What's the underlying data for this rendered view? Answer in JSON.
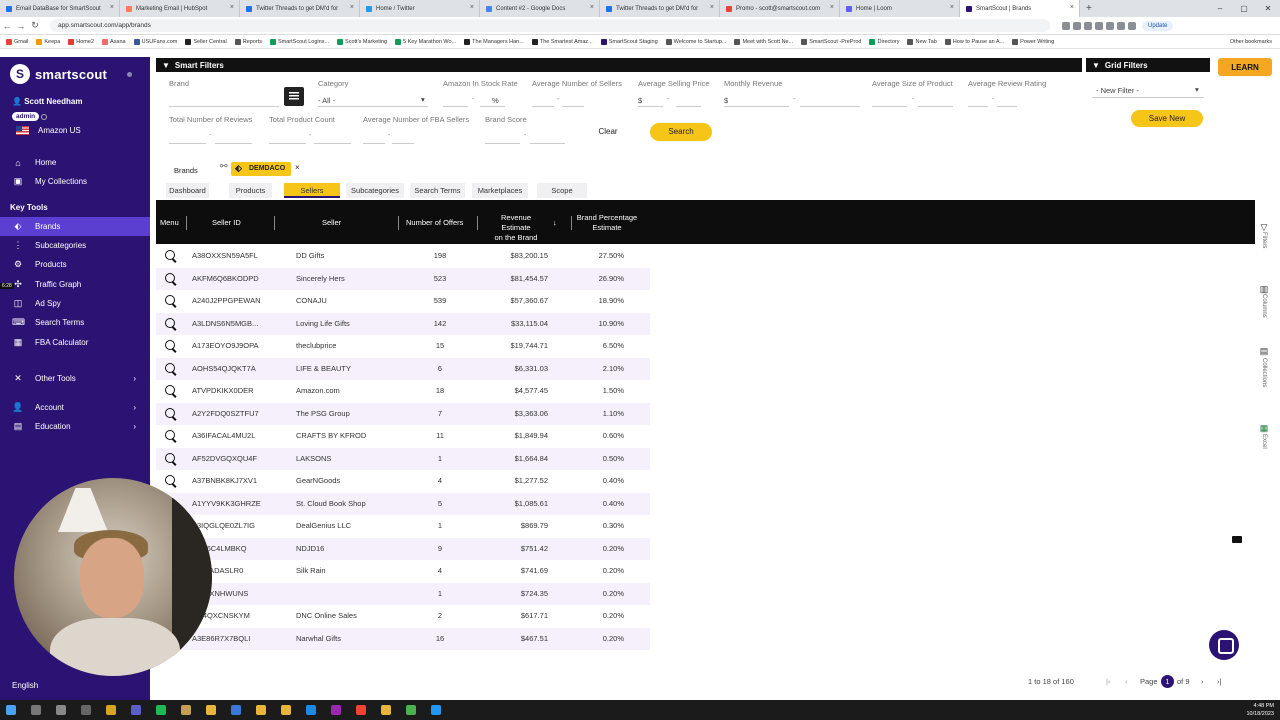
{
  "browser": {
    "tabs": [
      {
        "label": "Email DataBase for SmartScout",
        "color": "#1a73e8"
      },
      {
        "label": "Marketing Email | HubSpot",
        "color": "#ff7a59"
      },
      {
        "label": "Twitter Threads to get DM'd for",
        "color": "#1a73e8"
      },
      {
        "label": "Home / Twitter",
        "color": "#1d9bf0"
      },
      {
        "label": "Content #2 - Google Docs",
        "color": "#4285f4"
      },
      {
        "label": "Twitter Threads to get DM'd for",
        "color": "#1a73e8"
      },
      {
        "label": "Promo - scott@smartscout.com",
        "color": "#ea4335"
      },
      {
        "label": "Home | Loom",
        "color": "#625df5"
      },
      {
        "label": "SmartScout | Brands",
        "color": "#2b1373"
      }
    ],
    "url": "app.smartscout.com/app/brands",
    "update_label": "Update",
    "bookmarks": [
      {
        "label": "Gmail",
        "color": "#ea4335"
      },
      {
        "label": "Keepa",
        "color": "#f29900"
      },
      {
        "label": "Home2",
        "color": "#e53935"
      },
      {
        "label": "Asana",
        "color": "#f06a6a"
      },
      {
        "label": "USUFans.com",
        "color": "#3b5998"
      },
      {
        "label": "Seller Central",
        "color": "#222222"
      },
      {
        "label": "Reports",
        "color": "#555555"
      },
      {
        "label": "SmartScout Logins...",
        "color": "#0f9d58"
      },
      {
        "label": "Scott's Marketing",
        "color": "#0f9d58"
      },
      {
        "label": "5 Key Marathon Wo...",
        "color": "#0f9d58"
      },
      {
        "label": "The Managers Han...",
        "color": "#222222"
      },
      {
        "label": "The Smartest Amaz...",
        "color": "#222222"
      },
      {
        "label": "SmartScout Staging",
        "color": "#2b1373"
      },
      {
        "label": "Welcome to Startup...",
        "color": "#555555"
      },
      {
        "label": "Meet with Scott Ne...",
        "color": "#555555"
      },
      {
        "label": "SmartScout -PreProd",
        "color": "#555555"
      },
      {
        "label": "Directory",
        "color": "#0f9d58"
      },
      {
        "label": "New Tab",
        "color": "#555555"
      },
      {
        "label": "How to Pause an A...",
        "color": "#555555"
      },
      {
        "label": "Power Writing",
        "color": "#555555"
      }
    ],
    "other_bookmarks": "Other bookmarks"
  },
  "sidebar": {
    "logo_text": "smartscout",
    "logo_mark": "S",
    "user_name": "Scott Needham",
    "role_badge": "admin",
    "marketplace": "Amazon US",
    "home": "Home",
    "my_collections": "My Collections",
    "key_tools_heading": "Key Tools",
    "tools": [
      {
        "label": "Brands",
        "icon": "tag-icon",
        "glyph": "⬖",
        "active": true
      },
      {
        "label": "Subcategories",
        "icon": "subcategories-icon",
        "glyph": "⋮"
      },
      {
        "label": "Products",
        "icon": "products-icon",
        "glyph": "⚙"
      },
      {
        "label": "Traffic Graph",
        "icon": "traffic-graph-icon",
        "glyph": "✣"
      },
      {
        "label": "Ad Spy",
        "icon": "ad-spy-icon",
        "glyph": "◫"
      },
      {
        "label": "Search Terms",
        "icon": "search-terms-icon",
        "glyph": "⌨"
      },
      {
        "label": "FBA Calculator",
        "icon": "calculator-icon",
        "glyph": "▦"
      }
    ],
    "other_tools": "Other Tools",
    "account": "Account",
    "education": "Education",
    "language": "English",
    "recording_time": "6:28"
  },
  "filters": {
    "title": "Smart Filters",
    "brand_label": "Brand",
    "category_label": "Category",
    "category_value": "- All -",
    "in_stock_label": "Amazon In Stock Rate",
    "in_stock_unit": "%",
    "num_sellers_label": "Average Number of Sellers",
    "price_label": "Average Selling Price",
    "price_unit": "$",
    "revenue_label": "Monthly Revenue",
    "revenue_unit": "$",
    "size_label": "Average Size of Product",
    "rating_label": "Average Review Rating",
    "reviews_label": "Total Number of Reviews",
    "product_count_label": "Total Product Count",
    "fba_sellers_label": "Average Number of FBA Sellers",
    "brand_score_label": "Brand Score",
    "range_dash": "-",
    "clear": "Clear",
    "search": "Search"
  },
  "grid_filters": {
    "title": "Grid Filters",
    "select_value": "- New Filter -",
    "save": "Save New"
  },
  "learn_button": "LEARN",
  "breadcrumb": {
    "root": "Brands",
    "chip": "DEMDACO",
    "close": "×"
  },
  "subtabs": [
    "Dashboard",
    "Products",
    "Sellers",
    "Subcategories",
    "Search Terms",
    "Marketplaces",
    "Scope"
  ],
  "active_subtab": "Sellers",
  "table": {
    "columns": {
      "menu": "Menu",
      "seller_id": "Seller ID",
      "seller": "Seller",
      "offers": "Number of Offers",
      "revenue_line1": "Revenue Estimate",
      "revenue_line2": "on the Brand",
      "pct_line1": "Brand Percentage",
      "pct_line2": "Estimate"
    },
    "rows": [
      {
        "id": "A38OXXSN59A5FL",
        "seller": "DD Gifts",
        "offers": "198",
        "revenue": "$83,200.15",
        "pct": "27.50%"
      },
      {
        "id": "AKFM6Q6BKODPD",
        "seller": "Sincerely Hers",
        "offers": "523",
        "revenue": "$81,454.57",
        "pct": "26.90%"
      },
      {
        "id": "A240J2PPGPEWAN",
        "seller": "CONAJU",
        "offers": "539",
        "revenue": "$57,360.67",
        "pct": "18.90%"
      },
      {
        "id": "A3LDNS6N5MGB...",
        "seller": "Loving Life Gifts",
        "offers": "142",
        "revenue": "$33,115.04",
        "pct": "10.90%"
      },
      {
        "id": "A173EOYO9J9OPA",
        "seller": "theclubprice",
        "offers": "15",
        "revenue": "$19,744.71",
        "pct": "6.50%"
      },
      {
        "id": "AOHS54QJQKT7A",
        "seller": "LIFE & BEAUTY",
        "offers": "6",
        "revenue": "$6,331.03",
        "pct": "2.10%"
      },
      {
        "id": "ATVPDKIKX0DER",
        "seller": "Amazon.com",
        "offers": "18",
        "revenue": "$4,577.45",
        "pct": "1.50%"
      },
      {
        "id": "A2Y2FDQ0SZTFU7",
        "seller": "The PSG Group",
        "offers": "7",
        "revenue": "$3,363.06",
        "pct": "1.10%"
      },
      {
        "id": "A36IFACAL4MU2L",
        "seller": "CRAFTS BY KFROD",
        "offers": "11",
        "revenue": "$1,849.94",
        "pct": "0.60%"
      },
      {
        "id": "AF52DVGQXQU4F",
        "seller": "LAKSONS",
        "offers": "1",
        "revenue": "$1,664.84",
        "pct": "0.50%"
      },
      {
        "id": "A37BNBK8KJ7XV1",
        "seller": "GearNGoods",
        "offers": "4",
        "revenue": "$1,277.52",
        "pct": "0.40%"
      },
      {
        "id": "A1YYV9KK3GHRZE",
        "seller": "St. Cloud Book Shop",
        "offers": "5",
        "revenue": "$1,085.61",
        "pct": "0.40%"
      },
      {
        "id": "A3IQGLQE0ZL7IG",
        "seller": "DealGenius LLC",
        "offers": "1",
        "revenue": "$869.79",
        "pct": "0.30%"
      },
      {
        "id": "A5N6C4LMBKQ",
        "seller": "NDJD16",
        "offers": "9",
        "revenue": "$751.42",
        "pct": "0.20%"
      },
      {
        "id": "WO8ADASLR0",
        "seller": "Silk Rain",
        "offers": "4",
        "revenue": "$741.69",
        "pct": "0.20%"
      },
      {
        "id": "KICPXNHWUNS",
        "seller": "",
        "offers": "1",
        "revenue": "$724.35",
        "pct": "0.20%"
      },
      {
        "id": "RU4QXCNSKYM",
        "seller": "DNC Online Sales",
        "offers": "2",
        "revenue": "$617.71",
        "pct": "0.20%"
      },
      {
        "id": "A3E86R7X7BQLI",
        "seller": "Narwhal Gifts",
        "offers": "16",
        "revenue": "$467.51",
        "pct": "0.20%"
      }
    ]
  },
  "right_panel": {
    "filters": "Filters",
    "columns": "Columns",
    "collections": "Collections",
    "excel": "Excel"
  },
  "pagination": {
    "summary": "1 to 18 of 160",
    "page_label": "Page",
    "current": "1",
    "of_label": "of 9"
  },
  "clock": {
    "time": "4:48 PM",
    "date": "10/18/2023"
  }
}
